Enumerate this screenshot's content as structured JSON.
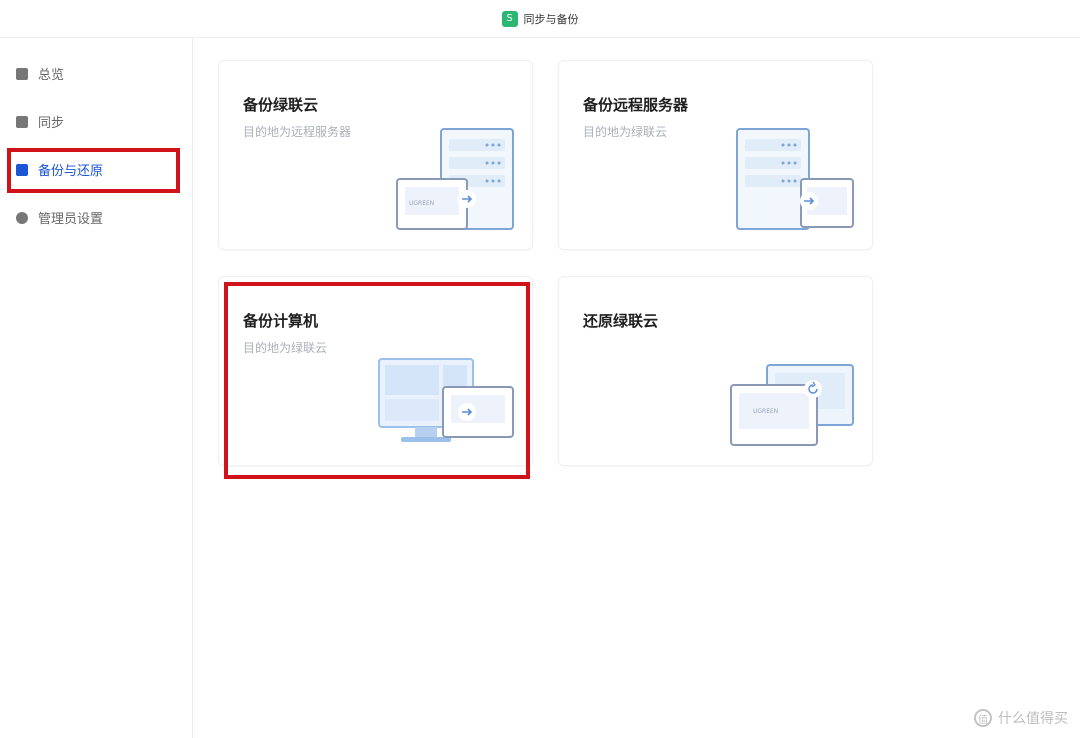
{
  "app": {
    "title": "同步与备份",
    "icon_glyph": "S",
    "accent": "#2bb673"
  },
  "sidebar": {
    "items": [
      {
        "label": "总览",
        "icon": "overview-icon"
      },
      {
        "label": "同步",
        "icon": "sync-icon"
      },
      {
        "label": "备份与还原",
        "icon": "backup-restore-icon",
        "active": true
      },
      {
        "label": "管理员设置",
        "icon": "gear-icon"
      }
    ],
    "active_color": "#1a56d6"
  },
  "cards": [
    {
      "title": "备份绿联云",
      "subtitle": "目的地为远程服务器"
    },
    {
      "title": "备份远程服务器",
      "subtitle": "目的地为绿联云"
    },
    {
      "title": "备份计算机",
      "subtitle": "目的地为绿联云"
    },
    {
      "title": "还原绿联云",
      "subtitle": ""
    }
  ],
  "illustration_text": {
    "device_label": "UGREEN"
  },
  "highlight_color": "#d0121b",
  "watermark": {
    "icon_glyph": "值",
    "text": "什么值得买"
  }
}
